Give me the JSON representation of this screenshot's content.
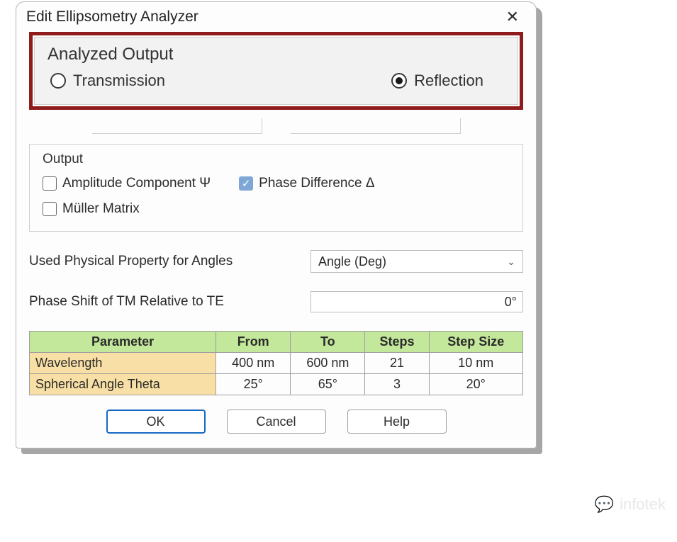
{
  "dialog": {
    "title": "Edit Ellipsometry Analyzer"
  },
  "analyzed_output": {
    "legend": "Analyzed Output",
    "transmission_label": "Transmission",
    "reflection_label": "Reflection",
    "selected": "reflection"
  },
  "output": {
    "legend": "Output",
    "amp_label": "Amplitude Component Ψ",
    "phase_label": "Phase Difference Δ",
    "muller_label": "Müller Matrix",
    "amp_checked": false,
    "phase_checked": true,
    "muller_checked": false
  },
  "angle_property": {
    "label": "Used Physical Property for Angles",
    "value": "Angle (Deg)"
  },
  "phase_shift": {
    "label": "Phase Shift of TM Relative to TE",
    "value": "0°"
  },
  "table": {
    "headers": [
      "Parameter",
      "From",
      "To",
      "Steps",
      "Step Size"
    ],
    "rows": [
      {
        "name": "Wavelength",
        "from": "400 nm",
        "to": "600 nm",
        "steps": "21",
        "step_size": "10 nm"
      },
      {
        "name": "Spherical Angle Theta",
        "from": "25°",
        "to": "65°",
        "steps": "3",
        "step_size": "20°"
      }
    ]
  },
  "buttons": {
    "ok": "OK",
    "cancel": "Cancel",
    "help": "Help"
  },
  "watermark": {
    "text": "infotek"
  }
}
